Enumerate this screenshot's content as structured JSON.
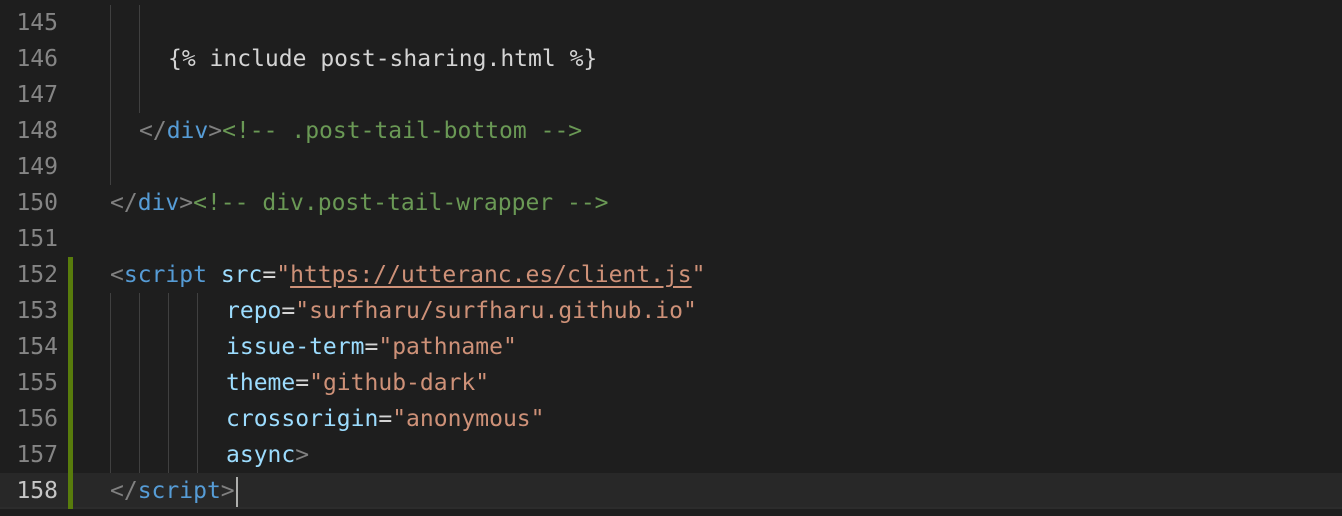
{
  "editor": {
    "current_line": "158",
    "lines": [
      {
        "num": "145"
      },
      {
        "num": "146",
        "text": "{% include post-sharing.html %}"
      },
      {
        "num": "147"
      },
      {
        "num": "148",
        "lt": "</",
        "tag": "div",
        "gt": ">",
        "comment": "<!-- .post-tail-bottom -->"
      },
      {
        "num": "149"
      },
      {
        "num": "150",
        "lt": "</",
        "tag": "div",
        "gt": ">",
        "comment": "<!-- div.post-tail-wrapper -->"
      },
      {
        "num": "151"
      },
      {
        "num": "152",
        "lt": "<",
        "tag": "script",
        "attr": "src",
        "eq": "=",
        "q1": "\"",
        "val": "https://utteranc.es/client.js",
        "q2": "\""
      },
      {
        "num": "153",
        "attr": "repo",
        "eq": "=",
        "val": "\"surfharu/surfharu.github.io\""
      },
      {
        "num": "154",
        "attr": "issue-term",
        "eq": "=",
        "val": "\"pathname\""
      },
      {
        "num": "155",
        "attr": "theme",
        "eq": "=",
        "val": "\"github-dark\""
      },
      {
        "num": "156",
        "attr": "crossorigin",
        "eq": "=",
        "val": "\"anonymous\""
      },
      {
        "num": "157",
        "attr": "async",
        "gt": ">"
      },
      {
        "num": "158",
        "lt": "</",
        "tag": "script",
        "gt": ">"
      }
    ]
  },
  "colors": {
    "background": "#1e1e1e",
    "tag": "#569cd6",
    "attribute": "#9cdcfe",
    "string": "#ce9178",
    "comment": "#6a9955",
    "modified_gutter": "#587c0c"
  }
}
